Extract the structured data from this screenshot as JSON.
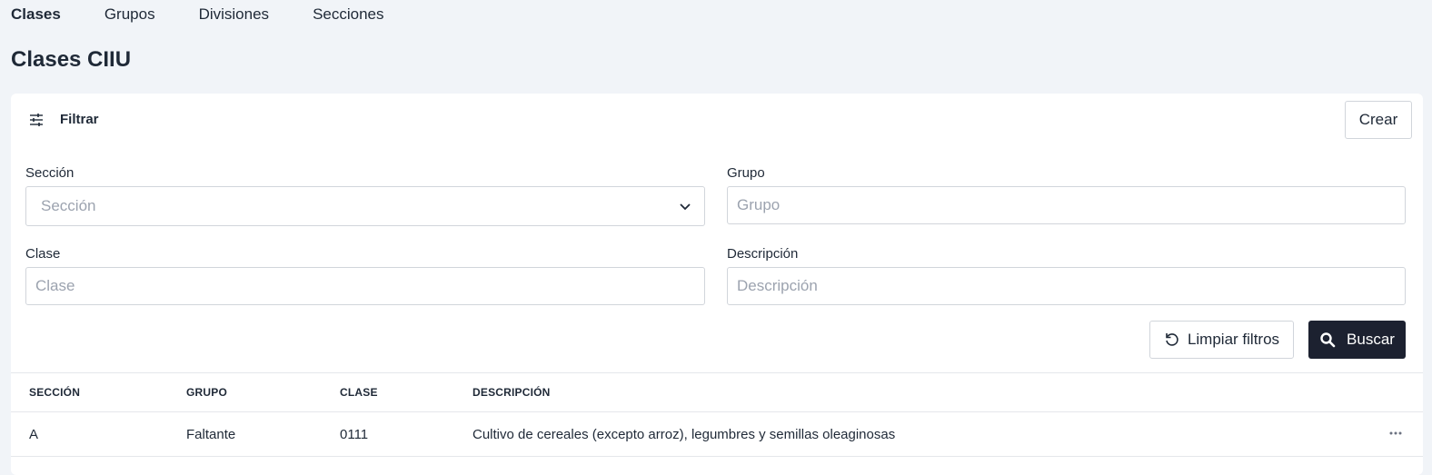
{
  "tabs": [
    {
      "label": "Clases",
      "active": true
    },
    {
      "label": "Grupos",
      "active": false
    },
    {
      "label": "Divisiones",
      "active": false
    },
    {
      "label": "Secciones",
      "active": false
    }
  ],
  "page": {
    "title": "Clases CIIU"
  },
  "filter": {
    "label": "Filtrar",
    "icon": "sliders-icon",
    "create_button": "Crear",
    "fields": {
      "seccion": {
        "label": "Sección",
        "placeholder": "Sección",
        "icon": "chevron-down-icon"
      },
      "grupo": {
        "label": "Grupo",
        "placeholder": "Grupo"
      },
      "clase": {
        "label": "Clase",
        "placeholder": "Clase"
      },
      "descripcion": {
        "label": "Descripción",
        "placeholder": "Descripción"
      }
    },
    "clear_button": {
      "label": "Limpiar filtros",
      "icon": "reset-icon"
    },
    "search_button": {
      "label": "Buscar",
      "icon": "search-icon"
    }
  },
  "table": {
    "columns": [
      "SECCIÓN",
      "GRUPO",
      "CLASE",
      "DESCRIPCIÓN"
    ],
    "rows": [
      {
        "seccion": "A",
        "grupo": "Faltante",
        "clase": "0111",
        "descripcion": "Cultivo de cereales (excepto arroz), legumbres y semillas oleaginosas",
        "menu_icon": "more-horizontal-icon"
      }
    ]
  },
  "colors": {
    "background": "#f1f4f8",
    "card": "#ffffff",
    "primary_button": "#1c2130",
    "border": "#d1d5db",
    "placeholder": "#9ca3af"
  }
}
